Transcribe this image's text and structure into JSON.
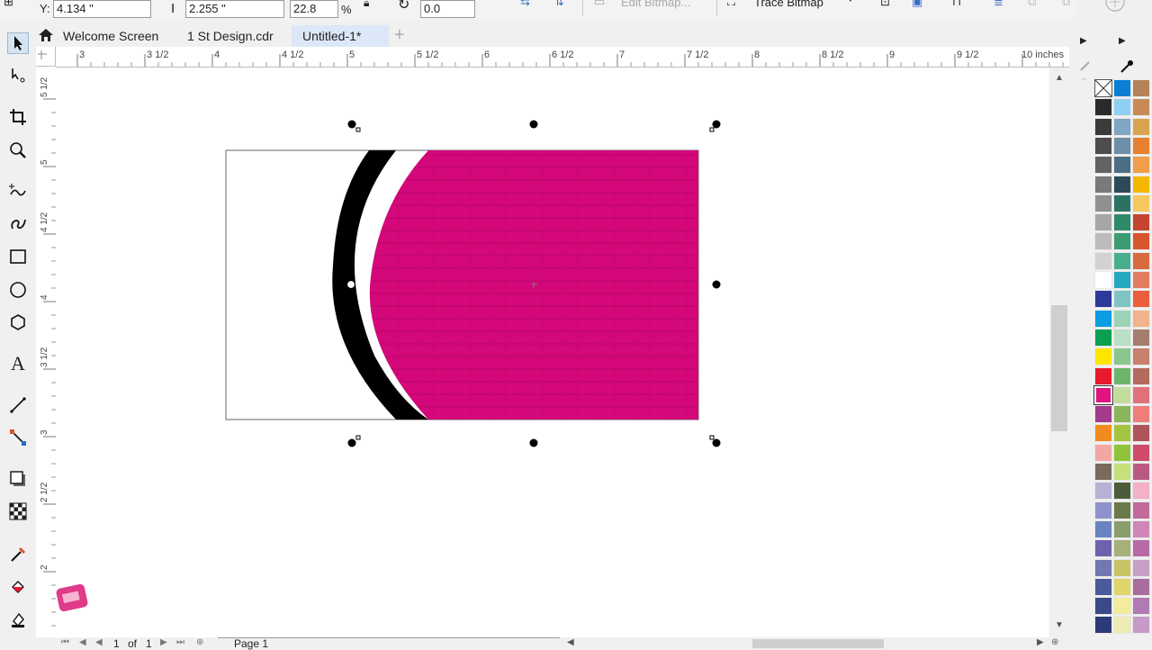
{
  "property_bar": {
    "y_label": "Y:",
    "y_value": "4.134 \"",
    "height_value": "2.255 \"",
    "scale_value": "22.8",
    "scale_unit": "%",
    "rotation_value": "0.0",
    "edit_bitmap_label": "Edit Bitmap...",
    "trace_bitmap_label": "Trace Bitmap"
  },
  "tabs": [
    {
      "label": "Welcome Screen"
    },
    {
      "label": "1 St Design.cdr"
    },
    {
      "label": "Untitled-1*"
    }
  ],
  "ruler": {
    "h_labels": [
      "3",
      "3 1/2",
      "4",
      "4 1/2",
      "5",
      "5 1/2",
      "6",
      "6 1/2",
      "7",
      "7 1/2",
      "8",
      "8 1/2",
      "9",
      "9 1/2",
      "10 inches"
    ],
    "v_labels": [
      "5 1/2",
      "5",
      "4 1/2",
      "4",
      "3 1/2",
      "3",
      "2 1/2",
      "2"
    ]
  },
  "page_nav": {
    "current": "1",
    "of_label": "of",
    "total": "1",
    "page_tab": "Page 1"
  },
  "colors": {
    "magenta": "#d4087a",
    "accent_tab": "#dce8f7"
  },
  "palette": [
    [
      "#ffffff",
      "#0a7fd4",
      "#b5835a"
    ],
    [
      "#2a2a2a",
      "#8ed0f2",
      "#c88a55"
    ],
    [
      "#3a3a3a",
      "#7fa6c2",
      "#d9a34f"
    ],
    [
      "#4d4d4d",
      "#6d8ea6",
      "#e8812f"
    ],
    [
      "#626262",
      "#4c6f83",
      "#f29d4a"
    ],
    [
      "#7a7a7a",
      "#2d4a5a",
      "#f5b800"
    ],
    [
      "#909090",
      "#2a7363",
      "#f7c75f"
    ],
    [
      "#a6a6a6",
      "#2f8a6a",
      "#c4442f"
    ],
    [
      "#bcbcbc",
      "#3b9b72",
      "#d9562c"
    ],
    [
      "#d2d2d2",
      "#48ad8c",
      "#d96a3e"
    ],
    [
      "#ffffff",
      "#27a8c2",
      "#e37d60"
    ],
    [
      "#2b3a9a",
      "#7ec4c4",
      "#ea5e3c"
    ],
    [
      "#0a9ee0",
      "#9bd3b9",
      "#f2b28c"
    ],
    [
      "#0aa050",
      "#b9dfc4",
      "#a67c6c"
    ],
    [
      "#ffe600",
      "#8ac68e",
      "#c6806b"
    ],
    [
      "#e8192c",
      "#6db56a",
      "#b46a5c"
    ],
    [
      "#e0147e",
      "#c2dc9c",
      "#e0717a"
    ],
    [
      "#a43a8c",
      "#8cb45a",
      "#ef7d7a"
    ],
    [
      "#f28b1f",
      "#a3c43e",
      "#b0545c"
    ],
    [
      "#f3a7a3",
      "#8fc43a",
      "#d04a6a"
    ],
    [
      "#7a6a5c",
      "#c6e07a",
      "#ba5a84"
    ],
    [
      "#b8b2d6",
      "#4c5c3a",
      "#f3b0c6"
    ],
    [
      "#8f93cc",
      "#6c7a4a",
      "#c26a9a"
    ],
    [
      "#6a84c2",
      "#8a9e6c",
      "#d086b6"
    ],
    [
      "#6e62ae",
      "#a6b07a",
      "#b86aa6"
    ],
    [
      "#7278b0",
      "#c8c466",
      "#c8a0c4"
    ],
    [
      "#4a5a9a",
      "#e0d46a",
      "#aa6c9c"
    ],
    [
      "#3a4a88",
      "#f2ec9c",
      "#b07ab4"
    ],
    [
      "#2c3a7a",
      "#eeeab4",
      "#c89ac8"
    ]
  ]
}
